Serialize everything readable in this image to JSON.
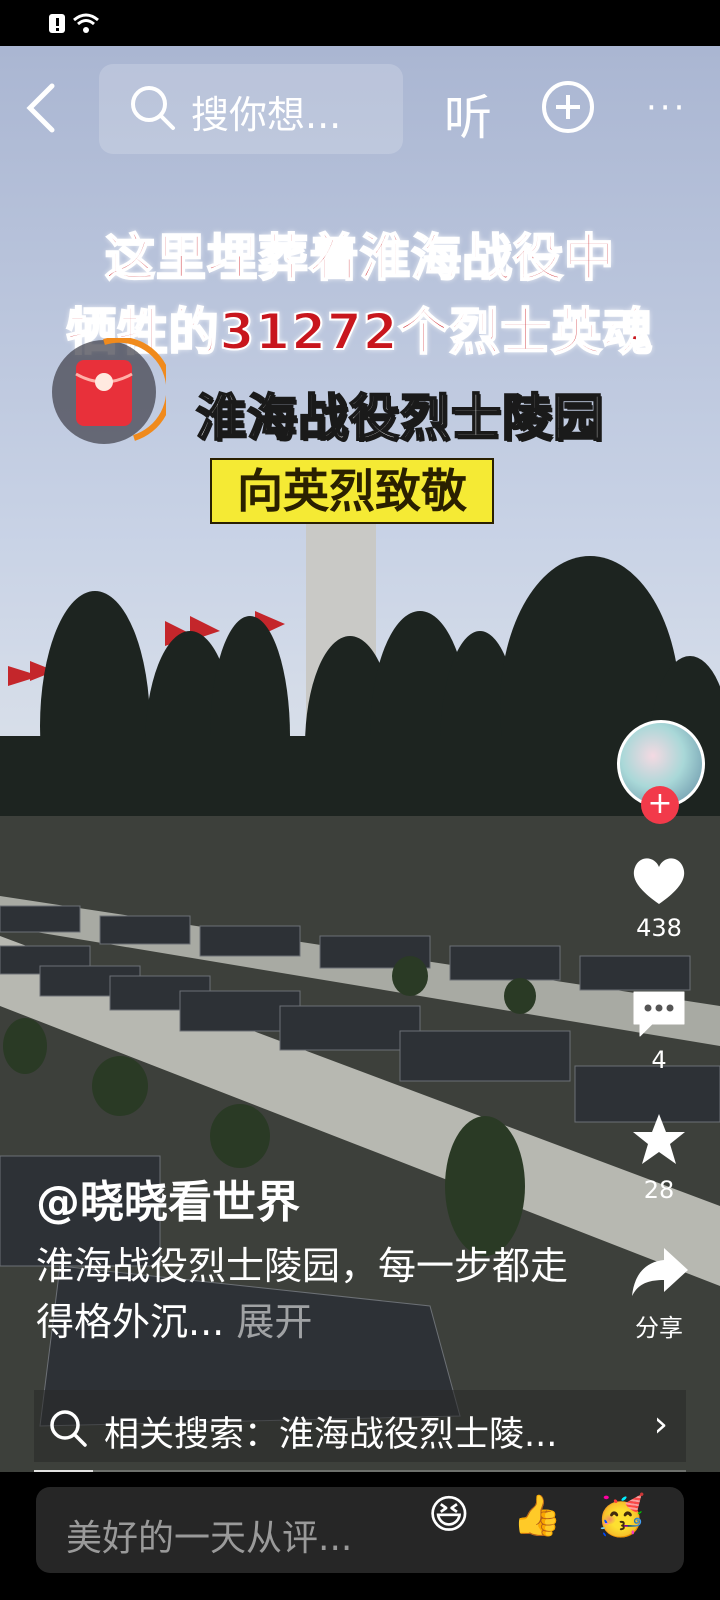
{
  "topbar": {
    "search_placeholder": "搜你想...",
    "listen_label": "听"
  },
  "headline": {
    "line1": "这里埋葬着淮海战役中",
    "line2": "牺牲的31272个烈士英魂",
    "line3": "淮海战役烈士陵园",
    "line4": "向英烈致敬"
  },
  "rail": {
    "likes": "438",
    "comments": "4",
    "favorites": "28",
    "share_label": "分享"
  },
  "post": {
    "author": "@晓晓看世界",
    "description": "淮海战役烈士陵园，每一步都走得格外沉...",
    "expand_label": "展开"
  },
  "related": {
    "text": "相关搜索：淮海战役烈士陵..."
  },
  "progress": {
    "fraction": 0.09
  },
  "comment": {
    "placeholder": "美好的一天从评...",
    "emojis": [
      "😆",
      "👍",
      "🥳"
    ]
  },
  "colors": {
    "headline_red": "#c8161d",
    "highlight_yellow": "#f5ea34",
    "follow_red": "#f23a4a"
  }
}
